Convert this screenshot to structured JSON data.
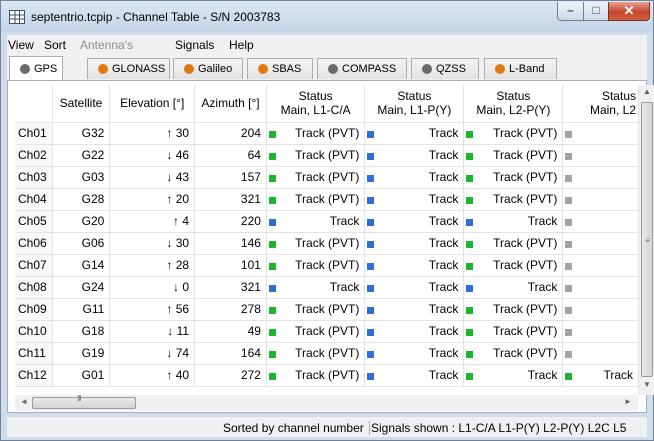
{
  "window": {
    "title": "septentrio.tcpip - Channel Table - S/N 2003783",
    "controls": {
      "minimize": "–",
      "maximize": "□",
      "close": "✕"
    }
  },
  "menu": [
    {
      "label": "View",
      "enabled": true
    },
    {
      "label": "Sort",
      "enabled": true
    },
    {
      "label": "Antenna's",
      "enabled": false
    },
    {
      "label": "Signals",
      "enabled": true
    },
    {
      "label": "Help",
      "enabled": true
    }
  ],
  "tabs": [
    {
      "label": "GPS",
      "icon": "globe-icon",
      "color": "#6a6a6a",
      "active": true
    },
    {
      "label": "GLONASS",
      "icon": "globe-icon",
      "color": "#e07a12",
      "active": false
    },
    {
      "label": "Galileo",
      "icon": "globe-icon",
      "color": "#e07a12",
      "active": false
    },
    {
      "label": "SBAS",
      "icon": "globe-icon",
      "color": "#e07a12",
      "active": false
    },
    {
      "label": "COMPASS",
      "icon": "globe-icon",
      "color": "#6a6a6a",
      "active": false
    },
    {
      "label": "QZSS",
      "icon": "globe-icon",
      "color": "#6a6a6a",
      "active": false
    },
    {
      "label": "L-Band",
      "icon": "globe-icon",
      "color": "#e07a12",
      "active": false
    }
  ],
  "table": {
    "headers": {
      "satellite": "Satellite",
      "elevation": "Elevation [°]",
      "azimuth": "Azimuth [°]",
      "status1": [
        "Status",
        "Main, L1-C/A"
      ],
      "status2": [
        "Status",
        "Main, L1-P(Y)"
      ],
      "status3": [
        "Status",
        "Main, L2-P(Y)"
      ],
      "status4": [
        "Status",
        "Main, L2"
      ]
    },
    "status_colors": {
      "green": "#1ab52a",
      "blue": "#2e6fd6",
      "gray": "#a3a3a3"
    },
    "rows": [
      {
        "ch": "Ch01",
        "sat": "G32",
        "elev": "↑ 30",
        "az": "204",
        "s1": [
          "Track (PVT)",
          "green"
        ],
        "s2": [
          "Track",
          "blue"
        ],
        "s3": [
          "Track (PVT)",
          "green"
        ],
        "s4": [
          "",
          "gray"
        ]
      },
      {
        "ch": "Ch02",
        "sat": "G22",
        "elev": "↓ 46",
        "az": "64",
        "s1": [
          "Track (PVT)",
          "green"
        ],
        "s2": [
          "Track",
          "blue"
        ],
        "s3": [
          "Track (PVT)",
          "green"
        ],
        "s4": [
          "",
          "gray"
        ]
      },
      {
        "ch": "Ch03",
        "sat": "G03",
        "elev": "↓ 43",
        "az": "157",
        "s1": [
          "Track (PVT)",
          "green"
        ],
        "s2": [
          "Track",
          "blue"
        ],
        "s3": [
          "Track (PVT)",
          "green"
        ],
        "s4": [
          "",
          "gray"
        ]
      },
      {
        "ch": "Ch04",
        "sat": "G28",
        "elev": "↑ 20",
        "az": "321",
        "s1": [
          "Track (PVT)",
          "green"
        ],
        "s2": [
          "Track",
          "blue"
        ],
        "s3": [
          "Track (PVT)",
          "green"
        ],
        "s4": [
          "",
          "gray"
        ]
      },
      {
        "ch": "Ch05",
        "sat": "G20",
        "elev": "↑ 4",
        "az": "220",
        "s1": [
          "Track",
          "blue"
        ],
        "s2": [
          "Track",
          "blue"
        ],
        "s3": [
          "Track",
          "blue"
        ],
        "s4": [
          "",
          "gray"
        ]
      },
      {
        "ch": "Ch06",
        "sat": "G06",
        "elev": "↓ 30",
        "az": "146",
        "s1": [
          "Track (PVT)",
          "green"
        ],
        "s2": [
          "Track",
          "blue"
        ],
        "s3": [
          "Track (PVT)",
          "green"
        ],
        "s4": [
          "",
          "gray"
        ]
      },
      {
        "ch": "Ch07",
        "sat": "G14",
        "elev": "↑ 28",
        "az": "101",
        "s1": [
          "Track (PVT)",
          "green"
        ],
        "s2": [
          "Track",
          "blue"
        ],
        "s3": [
          "Track (PVT)",
          "green"
        ],
        "s4": [
          "",
          "gray"
        ]
      },
      {
        "ch": "Ch08",
        "sat": "G24",
        "elev": "↓ 0",
        "az": "321",
        "s1": [
          "Track",
          "blue"
        ],
        "s2": [
          "Track",
          "blue"
        ],
        "s3": [
          "Track",
          "blue"
        ],
        "s4": [
          "",
          "gray"
        ]
      },
      {
        "ch": "Ch09",
        "sat": "G11",
        "elev": "↑ 56",
        "az": "278",
        "s1": [
          "Track (PVT)",
          "green"
        ],
        "s2": [
          "Track",
          "blue"
        ],
        "s3": [
          "Track (PVT)",
          "green"
        ],
        "s4": [
          "",
          "gray"
        ]
      },
      {
        "ch": "Ch10",
        "sat": "G18",
        "elev": "↓ 11",
        "az": "49",
        "s1": [
          "Track (PVT)",
          "green"
        ],
        "s2": [
          "Track",
          "blue"
        ],
        "s3": [
          "Track (PVT)",
          "green"
        ],
        "s4": [
          "",
          "gray"
        ]
      },
      {
        "ch": "Ch11",
        "sat": "G19",
        "elev": "↓ 74",
        "az": "164",
        "s1": [
          "Track (PVT)",
          "green"
        ],
        "s2": [
          "Track",
          "blue"
        ],
        "s3": [
          "Track (PVT)",
          "green"
        ],
        "s4": [
          "",
          "gray"
        ]
      },
      {
        "ch": "Ch12",
        "sat": "G01",
        "elev": "↑ 40",
        "az": "272",
        "s1": [
          "Track (PVT)",
          "green"
        ],
        "s2": [
          "Track",
          "blue"
        ],
        "s3": [
          "Track",
          "green"
        ],
        "s4": [
          "Track",
          "green"
        ]
      }
    ]
  },
  "scrollbars": {
    "grip": "≡",
    "hgrip": "III",
    "up": "▲",
    "down": "▼",
    "left": "◄",
    "right": "►"
  },
  "statusbar": {
    "sort": "Sorted by channel number",
    "signals": "Signals shown : L1-C/A  L1-P(Y)  L2-P(Y)  L2C  L5"
  }
}
